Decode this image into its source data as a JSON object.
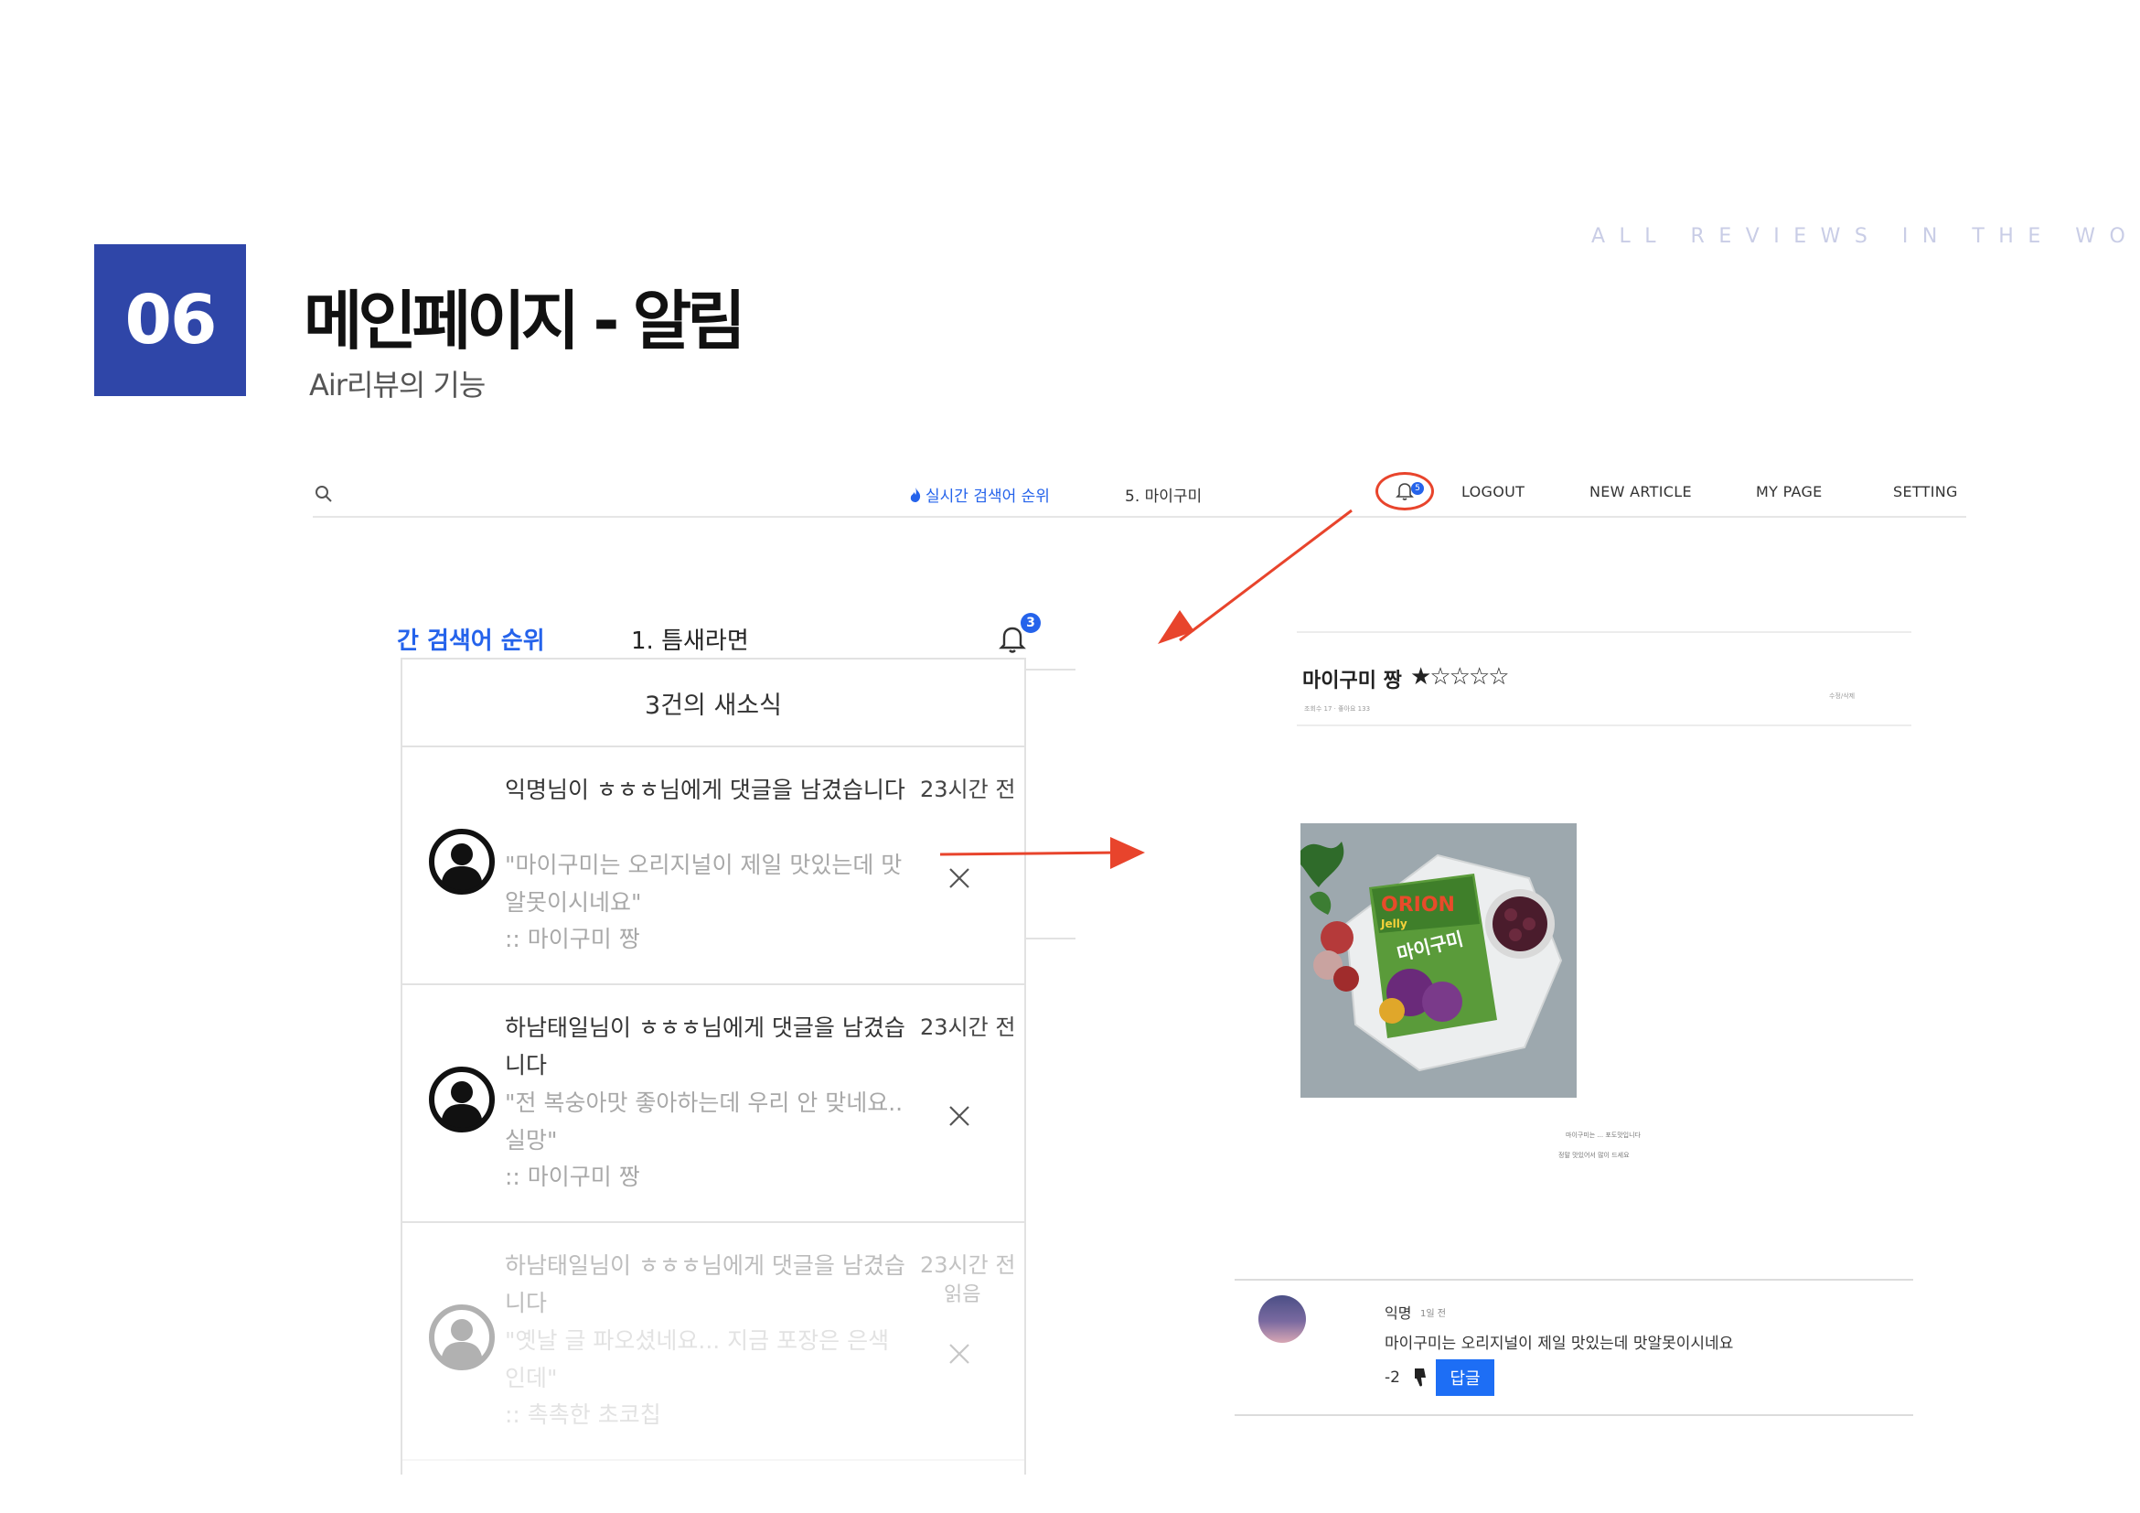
{
  "header": {
    "tagline": "ALL REVIEWS IN THE WORLD",
    "section_number": "06",
    "title": "메인페이지 - 알림",
    "subtitle": "Air리뷰의 기능"
  },
  "navbar": {
    "search_icon": "search-icon",
    "trending_label": "실시간 검색어 순위",
    "trending_rank": "5. 마이구미",
    "notification_count": "5",
    "links": [
      "LOGOUT",
      "NEW ARTICLE",
      "MY PAGE",
      "SETTING"
    ]
  },
  "notification_panel": {
    "trending_label": "간 검색어 순위",
    "trending_rank": "1. 틈새라면",
    "notification_count": "3",
    "heading": "3건의 새소식",
    "items": [
      {
        "message": "익명님이 ㅎㅎㅎ님에게 댓글을 남겼습니다",
        "quote": "\"마이구미는 오리지널이 제일 맛있는데 맛알못이시네요\"",
        "source": ":: 마이구미 짱",
        "time": "23시간 전",
        "status": ""
      },
      {
        "message": "하남태일님이 ㅎㅎㅎ님에게 댓글을 남겼습니다",
        "quote": "\"전 복숭아맛 좋아하는데 우리 안 맞네요.. 실망\"",
        "source": ":: 마이구미 짱",
        "time": "23시간 전",
        "status": ""
      },
      {
        "message": "하남태일님이 ㅎㅎㅎ님에게 댓글을 남겼습니다",
        "quote": "\"옛날 글 파오셨네요... 지금 포장은 은색인데\"",
        "source": ":: 촉촉한 초코칩",
        "time": "23시간 전",
        "status": "읽음"
      }
    ]
  },
  "article": {
    "title": "마이구미 짱",
    "rating": 1,
    "max_rating": 5,
    "meta": "조회수 17 · 좋아요 133",
    "action": "수정/삭제",
    "caption_line1": "마이구미는 ... 포도맛입니다",
    "caption_line2": "정말 맛있어서 많이 드세요",
    "image_text": {
      "brand": "ORION",
      "sub": "Jelly",
      "product": "마이구미"
    }
  },
  "comment": {
    "author": "익명",
    "age": "1일 전",
    "text": "마이구미는 오리지널이 제일 맛있는데 맛알못이시네요",
    "score": "-2",
    "reply_label": "답글"
  },
  "colors": {
    "accent_blue": "#2f46a8",
    "link_blue": "#2563eb",
    "arrow_red": "#e8442c",
    "reply_button": "#1d6ef5"
  }
}
